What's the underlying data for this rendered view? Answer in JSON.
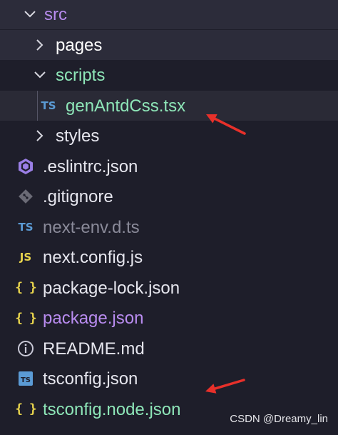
{
  "explorer": {
    "items": [
      {
        "label": "src",
        "kind": "folder-open",
        "indent": 0,
        "color": "#b98cf0",
        "icon": "chevron-down-icon"
      },
      {
        "label": "pages",
        "kind": "folder",
        "indent": 1,
        "color": "#ffffff",
        "icon": "chevron-right-icon"
      },
      {
        "label": "scripts",
        "kind": "folder-open",
        "indent": 1,
        "color": "#8ee6b8",
        "icon": "chevron-down-icon"
      },
      {
        "label": "genAntdCss.tsx",
        "kind": "file",
        "indent": 2,
        "color": "#8ee6b8",
        "icon": "typescript-icon",
        "badge": "TS"
      },
      {
        "label": "styles",
        "kind": "folder",
        "indent": 1,
        "color": "#e6e6ee",
        "icon": "chevron-right-icon"
      },
      {
        "label": ".eslintrc.json",
        "kind": "file",
        "indent": 0,
        "color": "#e6e6ee",
        "icon": "eslint-icon"
      },
      {
        "label": ".gitignore",
        "kind": "file",
        "indent": 0,
        "color": "#e6e6ee",
        "icon": "git-icon"
      },
      {
        "label": "next-env.d.ts",
        "kind": "file",
        "indent": 0,
        "color": "#8a8a99",
        "icon": "typescript-icon",
        "badge": "TS"
      },
      {
        "label": "next.config.js",
        "kind": "file",
        "indent": 0,
        "color": "#e6e6ee",
        "icon": "javascript-icon",
        "badge": "JS"
      },
      {
        "label": "package-lock.json",
        "kind": "file",
        "indent": 0,
        "color": "#e6e6ee",
        "icon": "json-icon",
        "badge": "{ }"
      },
      {
        "label": "package.json",
        "kind": "file",
        "indent": 0,
        "color": "#b98cf0",
        "icon": "json-icon",
        "badge": "{ }"
      },
      {
        "label": "README.md",
        "kind": "file",
        "indent": 0,
        "color": "#e6e6ee",
        "icon": "info-icon"
      },
      {
        "label": "tsconfig.json",
        "kind": "file",
        "indent": 0,
        "color": "#e6e6ee",
        "icon": "tsconfig-icon",
        "badge": "TS"
      },
      {
        "label": "tsconfig.node.json",
        "kind": "file",
        "indent": 0,
        "color": "#8ee6b8",
        "icon": "json-icon",
        "badge": "{ }"
      }
    ]
  },
  "watermark": "CSDN @Dreamy_lin",
  "colors": {
    "background": "#1e1e2a",
    "arrow": "#e8302a",
    "json_yellow": "#e8d44d",
    "ts_blue": "#5b9bd5",
    "eslint_purple": "#9b7fe6"
  }
}
